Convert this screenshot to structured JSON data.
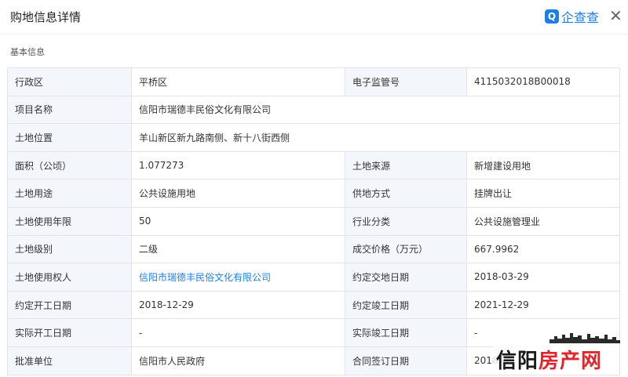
{
  "header": {
    "title": "购地信息详情",
    "brand_icon": "Q",
    "brand_name": "企查查",
    "close": "✕"
  },
  "section": {
    "title": "基本信息"
  },
  "rows": [
    {
      "k1": "行政区",
      "v1": "平桥区",
      "k2": "电子监管号",
      "v2": "4115032018B00018"
    },
    {
      "k1": "项目名称",
      "v1": "信阳市瑞德丰民俗文化有限公司"
    },
    {
      "k1": "土地位置",
      "v1": "羊山新区新九路南侧、新十八街西侧"
    },
    {
      "k1": "面积（公顷）",
      "v1": "1.077273",
      "k2": "土地来源",
      "v2": "新增建设用地"
    },
    {
      "k1": "土地用途",
      "v1": "公共设施用地",
      "k2": "供地方式",
      "v2": "挂牌出让"
    },
    {
      "k1": "土地使用年限",
      "v1": "50",
      "k2": "行业分类",
      "v2": "公共设施管理业"
    },
    {
      "k1": "土地级别",
      "v1": "二级",
      "k2": "成交价格（万元）",
      "v2": "667.9962"
    },
    {
      "k1": "土地使用权人",
      "v1": "信阳市瑞德丰民俗文化有限公司",
      "k2": "约定交地日期",
      "v2": "2018-03-29"
    },
    {
      "k1": "约定开工日期",
      "v1": "2018-12-29",
      "k2": "约定竣工日期",
      "v2": "2021-12-29"
    },
    {
      "k1": "实际开工日期",
      "v1": "-",
      "k2": "实际竣工日期",
      "v2": "-"
    },
    {
      "k1": "批准单位",
      "v1": "信阳市人民政府",
      "k2": "合同签订日期",
      "v2": "2018"
    }
  ],
  "watermark": {
    "part1": "信阳",
    "part2": "房产网"
  },
  "colors": {
    "accent": "#1d7fe0",
    "label_bg": "#f3f7fc",
    "border": "#e4e4e4",
    "watermark_red": "#e0262a"
  }
}
